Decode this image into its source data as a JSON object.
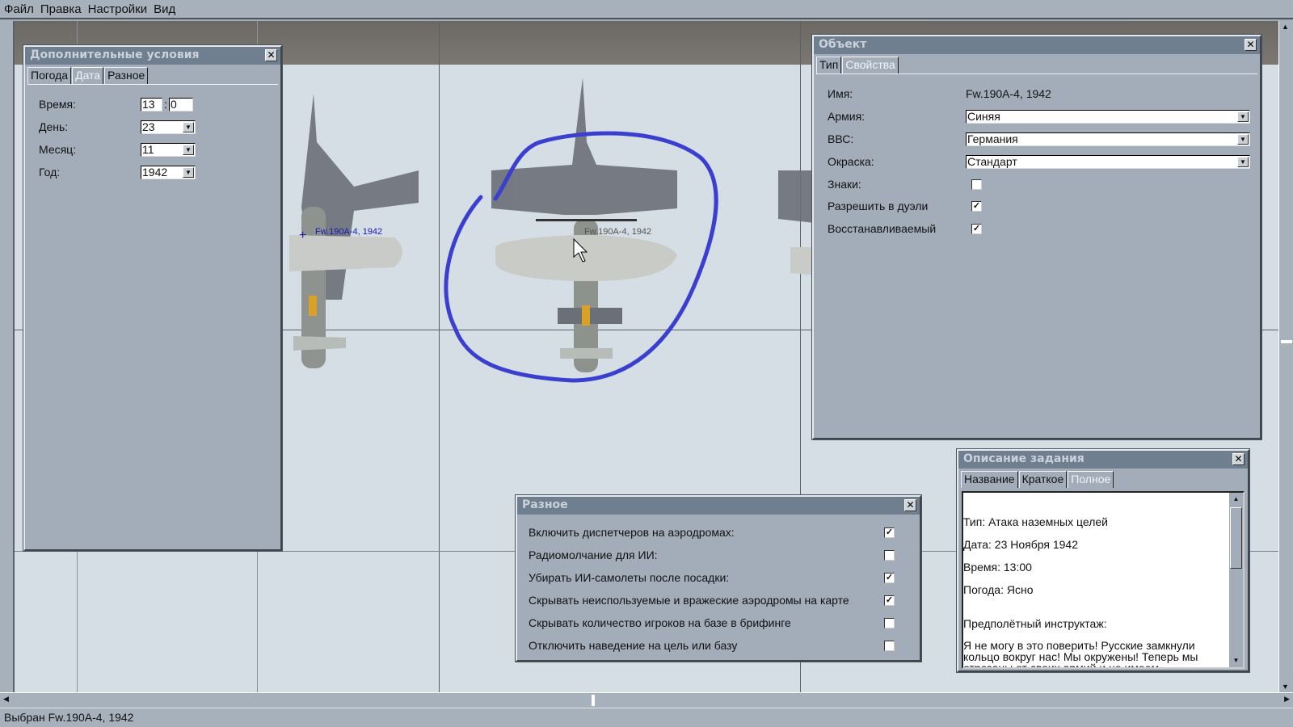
{
  "menu": [
    "Файл",
    "Правка",
    "Настройки",
    "Вид"
  ],
  "map": {
    "plane_labels": [
      "Fw.190A-4, 1942",
      "Fw.190A-4, 1942"
    ],
    "annotation_color": "#3a3fd0"
  },
  "conditions": {
    "title": "Дополнительные условия",
    "tabs": [
      "Погода",
      "Дата",
      "Разное"
    ],
    "active_tab": "Дата",
    "time_label": "Время:",
    "hour": "13",
    "minute": "0",
    "day_label": "День:",
    "day": "23",
    "month_label": "Месяц:",
    "month": "11",
    "year_label": "Год:",
    "year": "1942"
  },
  "object": {
    "title": "Объект",
    "tabs": [
      "Тип",
      "Свойства"
    ],
    "active_tab": "Свойства",
    "name_label": "Имя:",
    "name": "Fw.190A-4, 1942",
    "army_label": "Армия:",
    "army": "Синяя",
    "airforce_label": "ВВС:",
    "airforce": "Германия",
    "skin_label": "Окраска:",
    "skin": "Стандарт",
    "markings_label": "Знаки:",
    "markings": false,
    "duel_label": "Разрешить в дуэли",
    "duel": true,
    "restorable_label": "Восстанавливаемый",
    "restorable": true
  },
  "misc": {
    "title": "Разное",
    "items": [
      {
        "label": "Включить диспетчеров на аэродромах:",
        "checked": true
      },
      {
        "label": "Радиомолчание для ИИ:",
        "checked": false
      },
      {
        "label": "Убирать ИИ-самолеты после посадки:",
        "checked": true
      },
      {
        "label": "Скрывать неиспользуемые и вражеские аэродромы на карте",
        "checked": true
      },
      {
        "label": "Скрывать количество игроков на базе в брифинге",
        "checked": false
      },
      {
        "label": "Отключить наведение на цель или базу",
        "checked": false
      }
    ]
  },
  "description": {
    "title": "Описание задания",
    "tabs": [
      "Название",
      "Краткое",
      "Полное"
    ],
    "active_tab": "Полное",
    "lines": [
      "Тип: Атака наземных целей",
      "Дата: 23 Ноября 1942",
      "Время: 13:00",
      "Погода: Ясно",
      "Предполётный инструктаж:",
      "Я не могу в это поверить! Русские замкнули кольцо вокруг нас! Мы окружены! Теперь мы отрезаны от своих армий и не имеем"
    ]
  },
  "status": "Выбран Fw.190A-4, 1942"
}
